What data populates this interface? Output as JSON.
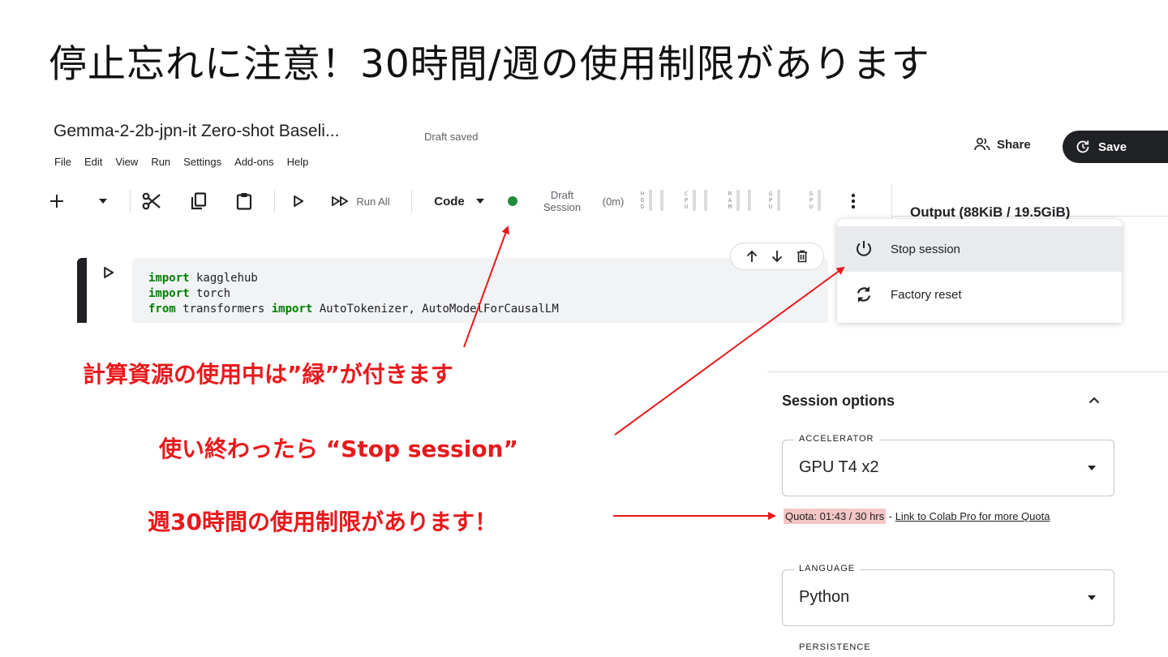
{
  "slide_title": "停止忘れに注意！30時間/週の使用制限があります",
  "notebook": {
    "title": "Gemma-2-2b-jpn-it Zero-shot Baseli...",
    "status": "Draft saved"
  },
  "menu": [
    "File",
    "Edit",
    "View",
    "Run",
    "Settings",
    "Add-ons",
    "Help"
  ],
  "header_actions": {
    "share_label": "Share",
    "save_label": "Save"
  },
  "toolbar": {
    "run_all_label": "Run All",
    "cell_type_label": "Code",
    "session_status_line1": "Draft",
    "session_status_line2": "Session",
    "session_time": "(0m)",
    "meters": [
      {
        "label": "HDD",
        "chars": [
          "H",
          "D",
          "D"
        ]
      },
      {
        "label": "CPU",
        "chars": [
          "C",
          "P",
          "U"
        ]
      },
      {
        "label": "RAM",
        "chars": [
          "R",
          "A",
          "M"
        ]
      },
      {
        "label": "GPU",
        "chars": [
          "G",
          "P",
          "U"
        ]
      },
      {
        "label": "GPU",
        "chars": [
          "G",
          "P",
          "U"
        ]
      }
    ],
    "session_indicator_color": "#1e8e3e"
  },
  "output_header": "Output (88KiB / 19.5GiB)",
  "session_menu": {
    "items": [
      {
        "label": "Stop session",
        "icon": "power-icon"
      },
      {
        "label": "Factory reset",
        "icon": "refresh-icon"
      }
    ]
  },
  "code_cell": {
    "lines": [
      {
        "kw": "import",
        "rest": " kagglehub"
      },
      {
        "kw": "import",
        "rest": " torch"
      },
      {
        "kw": "from",
        "rest": " transformers ",
        "kw2": "import",
        "rest2": " AutoTokenizer, AutoModelForCausalLM"
      }
    ]
  },
  "annotations": {
    "green_note": "計算資源の使用中は”緑”が付きます",
    "stop_note": "使い終わったら “Stop session”",
    "quota_note": "週30時間の使用制限があります！",
    "color": "#e8191c"
  },
  "session_options": {
    "title": "Session options",
    "accelerator_label": "ACCELERATOR",
    "accelerator_value": "GPU T4 x2",
    "quota_text": "Quota: 01:43 / 30 hrs",
    "quota_separator": " - ",
    "quota_link": "Link to Colab Pro for more Quota",
    "language_label": "LANGUAGE",
    "language_value": "Python",
    "persistence_label": "PERSISTENCE"
  }
}
